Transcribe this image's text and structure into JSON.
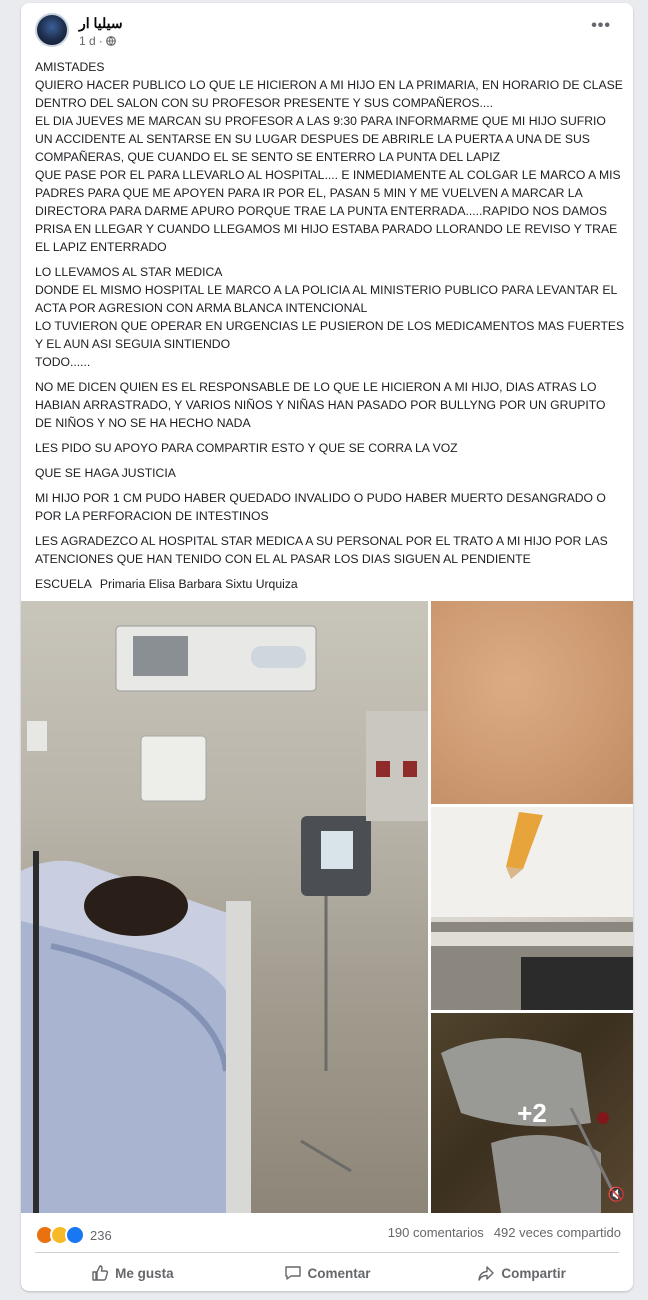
{
  "post": {
    "author": "سيليا ار",
    "time": "1 d",
    "more_label": "•••",
    "paragraphs": [
      "AMISTADES\nQUIERO HACER PUBLICO LO QUE LE HICIERON A MI HIJO EN LA PRIMARIA, EN HORARIO DE CLASE DENTRO DEL SALON CON SU PROFESOR PRESENTE Y SUS COMPAÑEROS....\nEL DIA JUEVES ME MARCAN SU PROFESOR A LAS 9:30 PARA INFORMARME QUE MI HIJO SUFRIO UN ACCIDENTE AL SENTARSE EN SU LUGAR DESPUES DE ABRIRLE LA PUERTA A UNA DE SUS COMPAÑERAS, QUE CUANDO EL SE SENTO SE ENTERRO LA PUNTA DEL LAPIZ\nQUE PASE POR EL PARA LLEVARLO AL HOSPITAL.... E INMEDIAMENTE AL COLGAR LE MARCO A MIS PADRES PARA QUE ME APOYEN PARA IR POR EL, PASAN 5 MIN Y ME VUELVEN A MARCAR LA DIRECTORA PARA DARME APURO PORQUE TRAE LA PUNTA ENTERRADA.....RAPIDO NOS DAMOS PRISA EN LLEGAR Y CUANDO LLEGAMOS MI HIJO ESTABA PARADO LLORANDO LE REVISO Y TRAE EL LAPIZ ENTERRADO",
      "LO LLEVAMOS AL STAR MEDICA\nDONDE EL MISMO HOSPITAL LE MARCO A LA POLICIA AL MINISTERIO PUBLICO PARA LEVANTAR EL ACTA POR AGRESION CON ARMA BLANCA INTENCIONAL\nLO TUVIERON QUE OPERAR EN URGENCIAS LE PUSIERON DE LOS MEDICAMENTOS MAS FUERTES Y EL AUN ASI SEGUIA SINTIENDO\nTODO......",
      "NO ME DICEN QUIEN ES EL RESPONSABLE DE LO QUE LE HICIERON A MI HIJO, DIAS ATRAS LO HABIAN ARRASTRADO, Y VARIOS NIÑOS Y NIÑAS HAN PASADO POR BULLYNG POR UN GRUPITO DE NIÑOS Y NO SE HA HECHO NADA",
      "LES PIDO SU APOYO PARA COMPARTIR ESTO Y QUE SE CORRA LA VOZ",
      "QUE SE HAGA JUSTICIA",
      "MI HIJO POR 1 CM PUDO HABER QUEDADO INVALIDO O PUDO HABER MUERTO DESANGRADO O POR LA PERFORACION DE INTESTINOS",
      "LES AGRADEZCO AL HOSPITAL STAR MEDICA A SU PERSONAL POR EL TRATO A MI HIJO POR LAS ATENCIONES QUE HAN TENIDO CON EL AL PASAR LOS DIAS SIGUEN AL PENDIENTE"
    ],
    "school_label": "ESCUELA",
    "school_name": "Primaria Elisa Barbara Sixtu Urquiza"
  },
  "media": {
    "more_count": "+2"
  },
  "stats": {
    "reaction_count": "236",
    "comments": "190 comentarios",
    "shares": "492 veces compartido"
  },
  "actions": {
    "like": "Me gusta",
    "comment": "Comentar",
    "share": "Compartir"
  },
  "colors": {
    "accent": "#1877f2",
    "muted": "#65676b"
  }
}
